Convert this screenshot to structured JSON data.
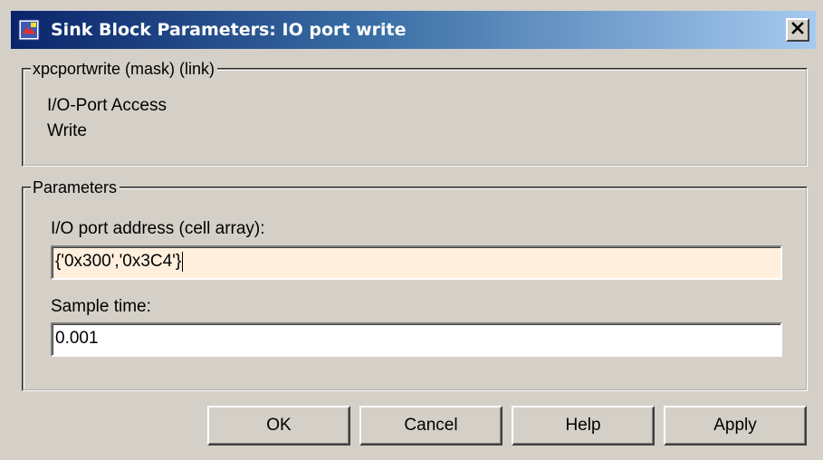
{
  "window": {
    "title": "Sink Block Parameters: IO port write",
    "close_icon": "close-icon",
    "app_icon": "simulink-block-icon"
  },
  "description": {
    "legend": "xpcportwrite (mask) (link)",
    "line1": "I/O-Port Access",
    "line2": "Write"
  },
  "parameters": {
    "legend": "Parameters",
    "address_label": "I/O port address (cell array):",
    "address_value": "{'0x300','0x3C4'}",
    "sample_time_label": "Sample time:",
    "sample_time_value": "0.001"
  },
  "buttons": {
    "ok": "OK",
    "cancel": "Cancel",
    "help": "Help",
    "apply": "Apply"
  },
  "colors": {
    "title_bar_start": "#0a246a",
    "title_bar_end": "#a6caf0",
    "dialog_background": "#d4d0c8",
    "active_field_background": "#ffefdc"
  }
}
